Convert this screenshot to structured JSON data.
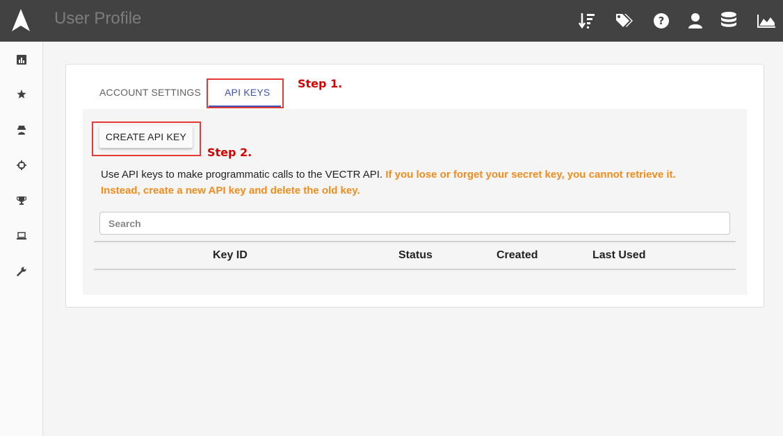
{
  "header": {
    "title": "User Profile",
    "icons": [
      "sort-icon",
      "tags-icon",
      "help-icon",
      "user-icon",
      "database-icon",
      "chart-icon"
    ]
  },
  "sidebar": {
    "items": [
      "dashboard-icon",
      "star-icon",
      "spy-icon",
      "crosshair-icon",
      "trophy-icon",
      "laptop-icon",
      "wrench-icon"
    ]
  },
  "tabs": {
    "account": "ACCOUNT SETTINGS",
    "api": "API KEYS"
  },
  "create_button": "CREATE API KEY",
  "annotations": {
    "step1": "Step 1.",
    "step2": "Step 2."
  },
  "info": {
    "text": "Use API keys to make programmatic calls to the VECTR API.",
    "warning": "If you lose or forget your secret key, you cannot retrieve it. Instead, create a new API key and delete the old key."
  },
  "search": {
    "placeholder": "Search"
  },
  "table": {
    "columns": [
      "Key ID",
      "Status",
      "Created",
      "Last Used"
    ]
  },
  "colors": {
    "topbar": "#424242",
    "accent": "#3f51b5",
    "warning": "#f28c1c",
    "annotation": "#d50000"
  }
}
